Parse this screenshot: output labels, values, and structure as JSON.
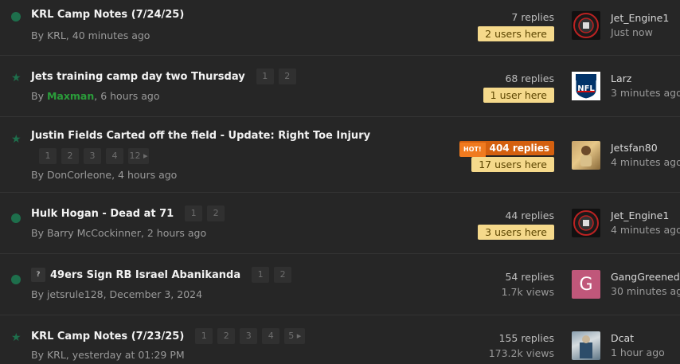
{
  "topics": [
    {
      "title": "KRL Camp Notes (7/24/25)",
      "byline": "By KRL, 40 minutes ago",
      "replies": "7 replies",
      "users_here": "2 users here",
      "last_user": "Jet_Engine1",
      "last_time": "Just now",
      "avatar": "krl-logo-icon"
    },
    {
      "title": "Jets training camp day two Thursday",
      "pages": [
        "1",
        "2"
      ],
      "byline_prefix": "By ",
      "byline_author": "Maxman",
      "byline_suffix": ", 6 hours ago",
      "replies": "68 replies",
      "users_here": "1 user here",
      "last_user": "Larz",
      "last_time": "3 minutes ago",
      "avatar": "nfl-logo-icon"
    },
    {
      "title": "Justin Fields Carted off the field - Update: Right Toe Injury",
      "pages": [
        "1",
        "2",
        "3",
        "4",
        "12 ▸"
      ],
      "byline": "By DonCorleone, 4 hours ago",
      "hot_label": "HOT!",
      "replies": "404 replies",
      "users_here": "17 users here",
      "last_user": "Jetsfan80",
      "last_time": "4 minutes ago",
      "avatar": "photo-avatar"
    },
    {
      "title": "Hulk Hogan - Dead at 71",
      "pages": [
        "1",
        "2"
      ],
      "byline": "By Barry McCockinner, 2 hours ago",
      "replies": "44 replies",
      "users_here": "3 users here",
      "last_user": "Jet_Engine1",
      "last_time": "4 minutes ago",
      "avatar": "krl-logo-icon"
    },
    {
      "prefix": "?",
      "title": "49ers Sign RB Israel Abanikanda",
      "pages": [
        "1",
        "2"
      ],
      "byline": "By jetsrule128, December 3, 2024",
      "replies": "54 replies",
      "views": "1.7k views",
      "last_user": "GangGreened",
      "last_time": "30 minutes ago",
      "avatar_letter": "G"
    },
    {
      "title": "KRL Camp Notes (7/23/25)",
      "pages": [
        "1",
        "2",
        "3",
        "4",
        "5 ▸"
      ],
      "byline": "By KRL, yesterday at 01:29 PM",
      "replies": "155 replies",
      "views": "173.2k views",
      "last_user": "Dcat",
      "last_time": "1 hour ago",
      "avatar": "photo-avatar"
    }
  ]
}
